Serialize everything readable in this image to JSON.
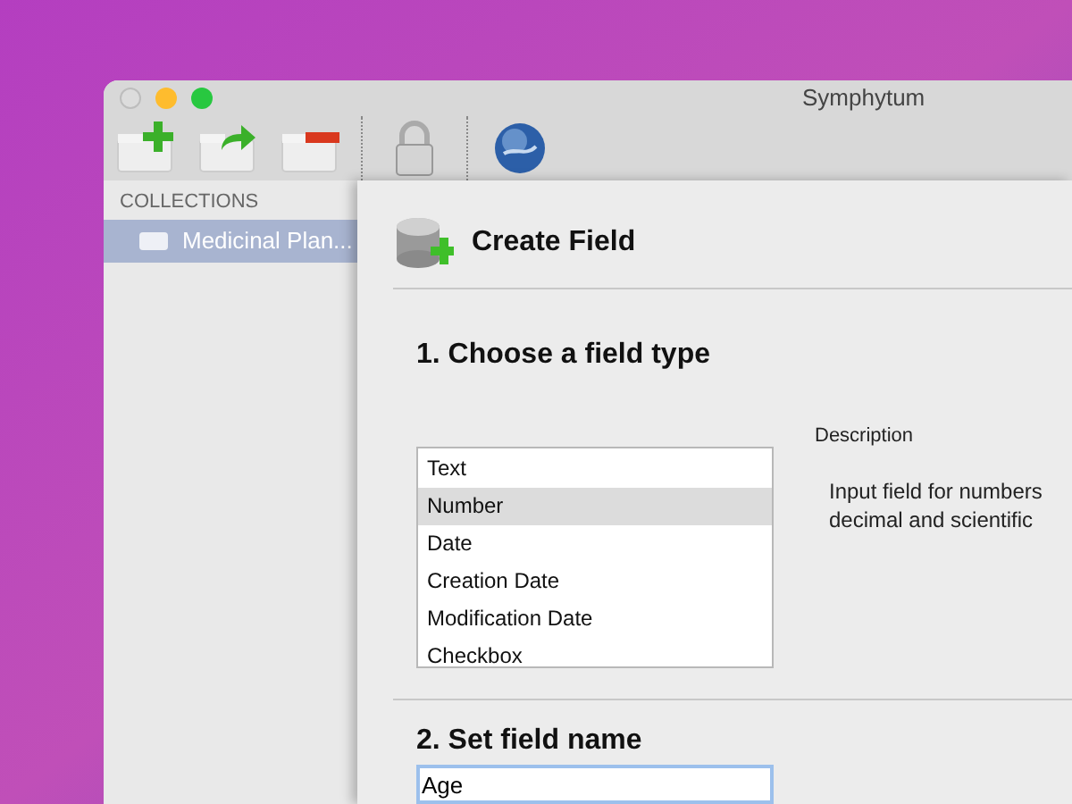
{
  "window": {
    "title": "Symphytum"
  },
  "toolbar": [
    {
      "kind": "add"
    },
    {
      "kind": "export"
    },
    {
      "kind": "remove"
    },
    {
      "kind": "lock"
    },
    {
      "kind": "globe"
    }
  ],
  "sidebar": {
    "heading": "COLLECTIONS",
    "items": [
      {
        "label": "Medicinal Plan...",
        "selected": true
      }
    ]
  },
  "sheet": {
    "title": "Create Field",
    "step1": {
      "heading": "1. Choose a field type",
      "types": [
        {
          "label": "Text",
          "selected": false
        },
        {
          "label": "Number",
          "selected": true
        },
        {
          "label": "Date",
          "selected": false
        },
        {
          "label": "Creation Date",
          "selected": false
        },
        {
          "label": "Modification Date",
          "selected": false
        },
        {
          "label": "Checkbox",
          "selected": false
        }
      ],
      "description_label": "Description",
      "description": [
        "Input field for numbers",
        "decimal and scientific"
      ]
    },
    "step2": {
      "heading": "2. Set field name",
      "value": "Age"
    }
  }
}
